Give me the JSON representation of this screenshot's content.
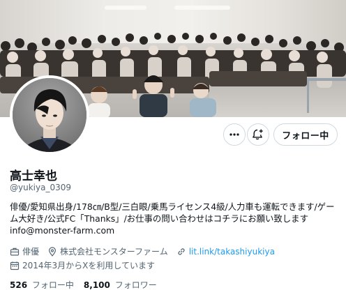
{
  "profile": {
    "display_name": "高士幸也",
    "handle": "@yukiya_0309",
    "bio_line1": "俳優/愛知県出身/178㎝/B型/三白眼/乗馬ライセンス4級/人力車も運転できます/ゲー",
    "bio_line2": "ム大好き/公式FC「Thanks」/お仕事の問い合わせはコチラにお願い致します",
    "bio_line3": "info@monster-farm.com",
    "category": "俳優",
    "location": "株式会社モンスターファーム",
    "website": "lit.link/takashiyukiya",
    "joined": "2014年3月からXを利用しています"
  },
  "actions": {
    "more_icon": "more-dots-icon",
    "notify_icon": "bell-plus-icon",
    "follow_label": "フォロー中"
  },
  "stats": {
    "following_count": "526",
    "following_label": "フォロー中",
    "followers_count": "8,100",
    "followers_label": "フォロワー"
  },
  "colors": {
    "text": "#0f1419",
    "secondary": "#536471",
    "link": "#1d9bf0",
    "border": "#cfd9de"
  }
}
